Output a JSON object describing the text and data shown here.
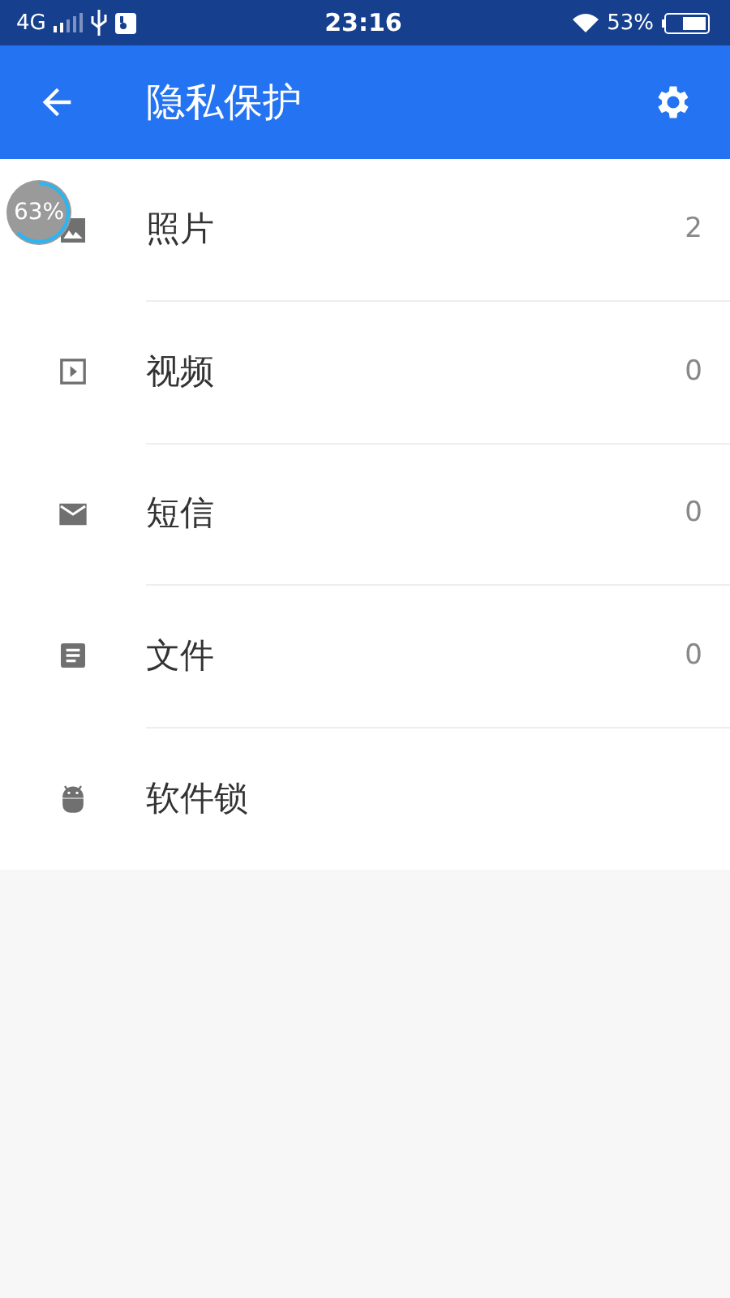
{
  "status_bar": {
    "network": "4G",
    "time": "23:16",
    "battery": "53%"
  },
  "app_bar": {
    "title": "隐私保护"
  },
  "items": [
    {
      "kind": "photo",
      "label": "照片",
      "count": "2"
    },
    {
      "kind": "video",
      "label": "视频",
      "count": "0"
    },
    {
      "kind": "message",
      "label": "短信",
      "count": "0"
    },
    {
      "kind": "file",
      "label": "文件",
      "count": "0"
    },
    {
      "kind": "applock",
      "label": "软件锁"
    }
  ],
  "floating_widget": {
    "reading": "63%",
    "level": 0.63
  }
}
